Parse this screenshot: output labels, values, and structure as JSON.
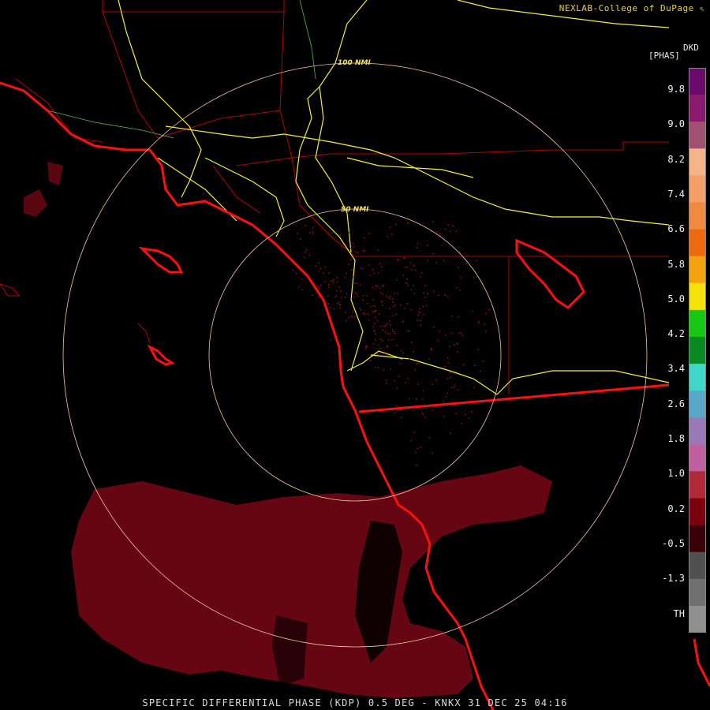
{
  "credit": "NEXLAB-College of DuPage",
  "credit_icon": "cursor-arrow-icon",
  "footer": "SPECIFIC DIFFERENTIAL PHASE (KDP) 0.5 DEG - KNKX 31 DEC 25 04:16",
  "rings": [
    {
      "label": "100 NMI"
    },
    {
      "label": "50 NMI"
    }
  ],
  "legend": {
    "title_right": "DKD",
    "title_left": "[PHAS]",
    "ticks": [
      "9.8",
      "9.0",
      "8.2",
      "7.4",
      "6.6",
      "5.8",
      "5.0",
      "4.2",
      "3.4",
      "2.6",
      "1.8",
      "1.0",
      "0.2",
      "-0.5",
      "-1.3",
      "TH"
    ],
    "colors": [
      "#6a0a6a",
      "#8a1a6e",
      "#a05070",
      "#f3b48a",
      "#f5a06a",
      "#f08a40",
      "#ee6a10",
      "#f3a30d",
      "#f5e20a",
      "#14c814",
      "#0a8a20",
      "#40d6c8",
      "#5aa6c8",
      "#9a7ab6",
      "#c060a0",
      "#b02a3a",
      "#7a0010",
      "#3a0008",
      "#505050",
      "#707070",
      "#909090"
    ]
  },
  "colors": {
    "coast": "#ff1010",
    "borders": "#b30000",
    "highways": "#f2f03a",
    "rings": "#f3c9a2",
    "echo": "#6a0710"
  }
}
